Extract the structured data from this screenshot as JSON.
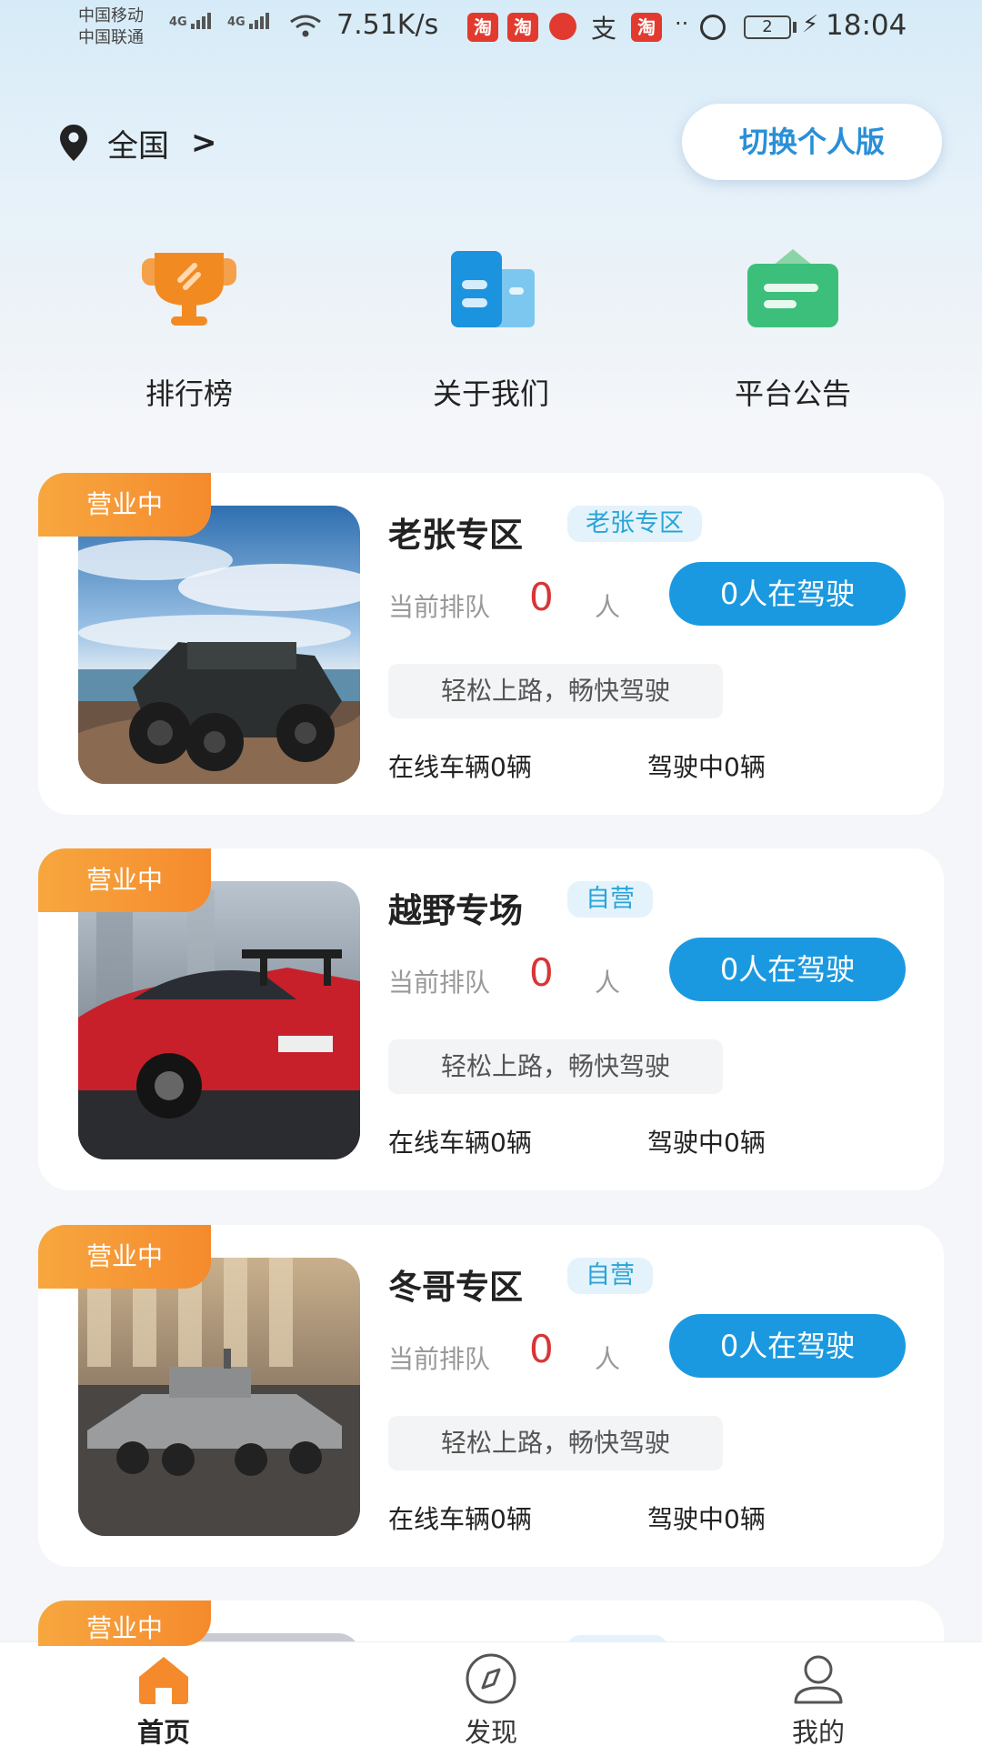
{
  "status_bar": {
    "carrier_1": "中国移动",
    "carrier_2": "中国联通",
    "net_1": "4G",
    "net_2": "4G",
    "net_speed": "7.51K/s",
    "app_badge_1": "淘",
    "app_badge_2": "淘",
    "app_badge_3": "淘",
    "alipay_glyph": "支",
    "dots": "··",
    "battery": "2",
    "time": "18:04"
  },
  "header": {
    "location": "全国",
    "switch_label": "切换个人版"
  },
  "quick_nav": [
    {
      "label": "排行榜",
      "icon": "trophy-icon"
    },
    {
      "label": "关于我们",
      "icon": "building-icon"
    },
    {
      "label": "平台公告",
      "icon": "notice-board-icon"
    }
  ],
  "cards": [
    {
      "status": "营业中",
      "title": "老张专区",
      "tag": "老张专区",
      "queue_label": "当前排队",
      "queue_count": "0",
      "queue_unit": "人",
      "drive_button": "0人在驾驶",
      "slogan": "轻松上路，畅快驾驶",
      "online": "在线车辆0辆",
      "driving": "驾驶中0辆"
    },
    {
      "status": "营业中",
      "title": "越野专场",
      "tag": "自营",
      "queue_label": "当前排队",
      "queue_count": "0",
      "queue_unit": "人",
      "drive_button": "0人在驾驶",
      "slogan": "轻松上路，畅快驾驶",
      "online": "在线车辆0辆",
      "driving": "驾驶中0辆"
    },
    {
      "status": "营业中",
      "title": "冬哥专区",
      "tag": "自营",
      "queue_label": "当前排队",
      "queue_count": "0",
      "queue_unit": "人",
      "drive_button": "0人在驾驶",
      "slogan": "轻松上路，畅快驾驶",
      "online": "在线车辆0辆",
      "driving": "驾驶中0辆"
    },
    {
      "status": "营业中"
    }
  ],
  "tabbar": [
    {
      "label": "首页",
      "icon": "home-icon",
      "active": true
    },
    {
      "label": "发现",
      "icon": "compass-icon",
      "active": false
    },
    {
      "label": "我的",
      "icon": "user-icon",
      "active": false
    }
  ],
  "colors": {
    "accent_blue": "#1b99e0",
    "status_orange": "#f58a2d",
    "queue_red": "#d93535",
    "tag_blue": "#2aa4d8"
  }
}
